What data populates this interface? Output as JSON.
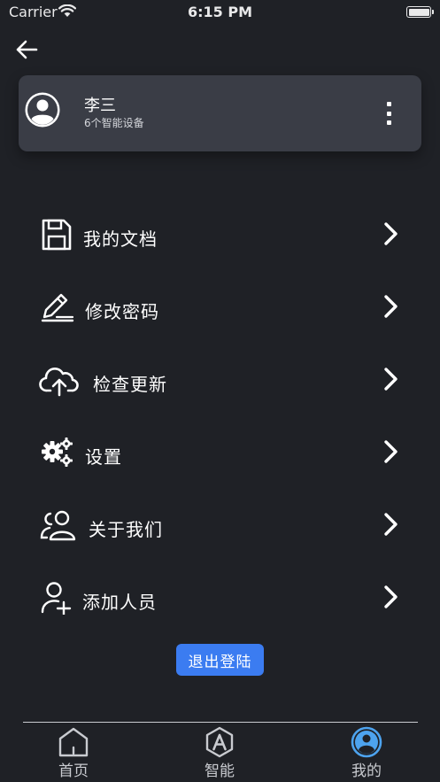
{
  "status_bar": {
    "carrier": "Carrier",
    "time": "6:15 PM"
  },
  "profile": {
    "name": "李三",
    "subtitle": "6个智能设备"
  },
  "menu": [
    {
      "label": "我的文档",
      "icon": "save-document-icon"
    },
    {
      "label": "修改密码",
      "icon": "edit-pen-icon"
    },
    {
      "label": "检查更新",
      "icon": "cloud-upload-icon"
    },
    {
      "label": "设置",
      "icon": "gears-icon"
    },
    {
      "label": "关于我们",
      "icon": "users-icon"
    },
    {
      "label": "添加人员",
      "icon": "add-user-icon"
    }
  ],
  "logout_label": "退出登陆",
  "tabs": [
    {
      "label": "首页",
      "icon": "home-icon",
      "active": false
    },
    {
      "label": "智能",
      "icon": "smart-a-icon",
      "active": false
    },
    {
      "label": "我的",
      "icon": "profile-icon",
      "active": true
    }
  ],
  "colors": {
    "background": "#1f2126",
    "card": "#3a3d46",
    "accent": "#3b7cf1"
  }
}
